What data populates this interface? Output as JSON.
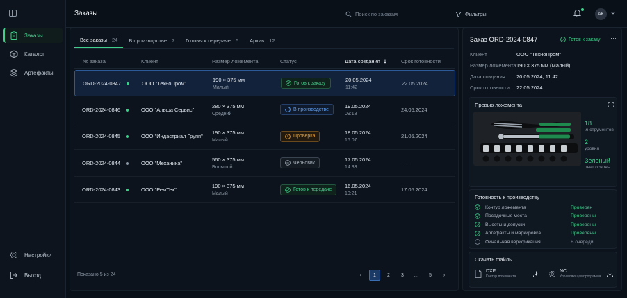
{
  "sidebar": {
    "items": [
      {
        "label": "Заказы",
        "icon": "clipboard-icon"
      },
      {
        "label": "Каталог",
        "icon": "cube-icon"
      },
      {
        "label": "Артефакты",
        "icon": "layers-icon"
      }
    ],
    "bottom": [
      {
        "label": "Настройки",
        "icon": "gear-icon"
      },
      {
        "label": "Выход",
        "icon": "logout-icon"
      }
    ]
  },
  "header": {
    "title": "Заказы",
    "search_placeholder": "Поиск по заказам",
    "filters_label": "Фильтры",
    "avatar_initials": "AK"
  },
  "tabs": [
    {
      "label": "Все заказы",
      "count": "24"
    },
    {
      "label": "В производстве",
      "count": "7"
    },
    {
      "label": "Готовы к передаче",
      "count": "5"
    },
    {
      "label": "Архив",
      "count": "12"
    }
  ],
  "table": {
    "columns": [
      "№ заказа",
      "Клиент",
      "Размер ложемента",
      "Статус",
      "Дата создания",
      "Срок готовности"
    ],
    "rows": [
      {
        "id": "ORD-2024-0847",
        "dot": "#3fd08c",
        "client": "ООО \"ТехноПром\"",
        "size": "190 × 375 мм",
        "size_label": "Малый",
        "status": "Готов к заказу",
        "status_kind": "ready",
        "created_date": "20.05.2024",
        "created_time": "11:42",
        "due": "22.05.2024"
      },
      {
        "id": "ORD-2024-0846",
        "dot": "#3fd08c",
        "client": "ООО \"Альфа Сервис\"",
        "size": "280 × 375 мм",
        "size_label": "Средний",
        "status": "В производстве",
        "status_kind": "prod",
        "created_date": "19.05.2024",
        "created_time": "09:18",
        "due": "24.05.2024"
      },
      {
        "id": "ORD-2024-0845",
        "dot": "#3fd08c",
        "client": "ООО \"Индастриал Групп\"",
        "size": "190 × 375 мм",
        "size_label": "Малый",
        "status": "Проверка",
        "status_kind": "check",
        "created_date": "18.05.2024",
        "created_time": "16:07",
        "due": "21.05.2024"
      },
      {
        "id": "ORD-2024-0844",
        "dot": "#8a96a4",
        "client": "ООО \"Механика\"",
        "size": "560 × 375 мм",
        "size_label": "Большой",
        "status": "Черновик",
        "status_kind": "draft",
        "created_date": "17.05.2024",
        "created_time": "14:33",
        "due": "—"
      },
      {
        "id": "ORD-2024-0843",
        "dot": "#3fd08c",
        "client": "ООО \"РемТех\"",
        "size": "190 × 375 мм",
        "size_label": "Малый",
        "status": "Готов к передаче",
        "status_kind": "ready",
        "created_date": "16.05.2024",
        "created_time": "10:21",
        "due": "17.05.2024"
      }
    ]
  },
  "footer": {
    "shown": "Показано 5 из 24",
    "pages": [
      "1",
      "2",
      "3",
      "…",
      "5"
    ],
    "current_page": "1"
  },
  "detail": {
    "title": "Заказ ORD-2024-0847",
    "status": "Готов к заказу",
    "fields": [
      {
        "k": "Клиент",
        "v": "ООО \"ТехноПром\""
      },
      {
        "k": "Размер ложемента",
        "v": "190 × 375 мм (Малый)"
      },
      {
        "k": "Дата создания",
        "v": "20.05.2024, 11:42"
      },
      {
        "k": "Срок готовности",
        "v": "22.05.2024"
      }
    ],
    "preview": {
      "title": "Превью ложемента",
      "stats": [
        {
          "num": "18",
          "label": "инструментов"
        },
        {
          "num": "2",
          "label": "уровня"
        },
        {
          "num": "Зеленый",
          "label": "цвет основы"
        }
      ]
    },
    "readiness": {
      "title": "Готовность к производству",
      "items": [
        {
          "label": "Контур ложемента",
          "status": "Проверен",
          "done": true
        },
        {
          "label": "Посадочные места",
          "status": "Проверены",
          "done": true
        },
        {
          "label": "Высоты и допуски",
          "status": "Проверены",
          "done": true
        },
        {
          "label": "Артефакты и маркировка",
          "status": "Проверены",
          "done": true
        },
        {
          "label": "Финальная верификация",
          "status": "В очереди",
          "done": false
        }
      ]
    },
    "downloads": {
      "title": "Скачать файлы",
      "files": [
        {
          "type": "DXF",
          "desc": "Контур ложемента"
        },
        {
          "type": "NC",
          "desc": "Управляющая программа"
        }
      ]
    }
  },
  "colors": {
    "accent": "#3fd08c",
    "selected": "#2c5a99",
    "warning": "#f0a73a",
    "info": "#5b9df2"
  }
}
